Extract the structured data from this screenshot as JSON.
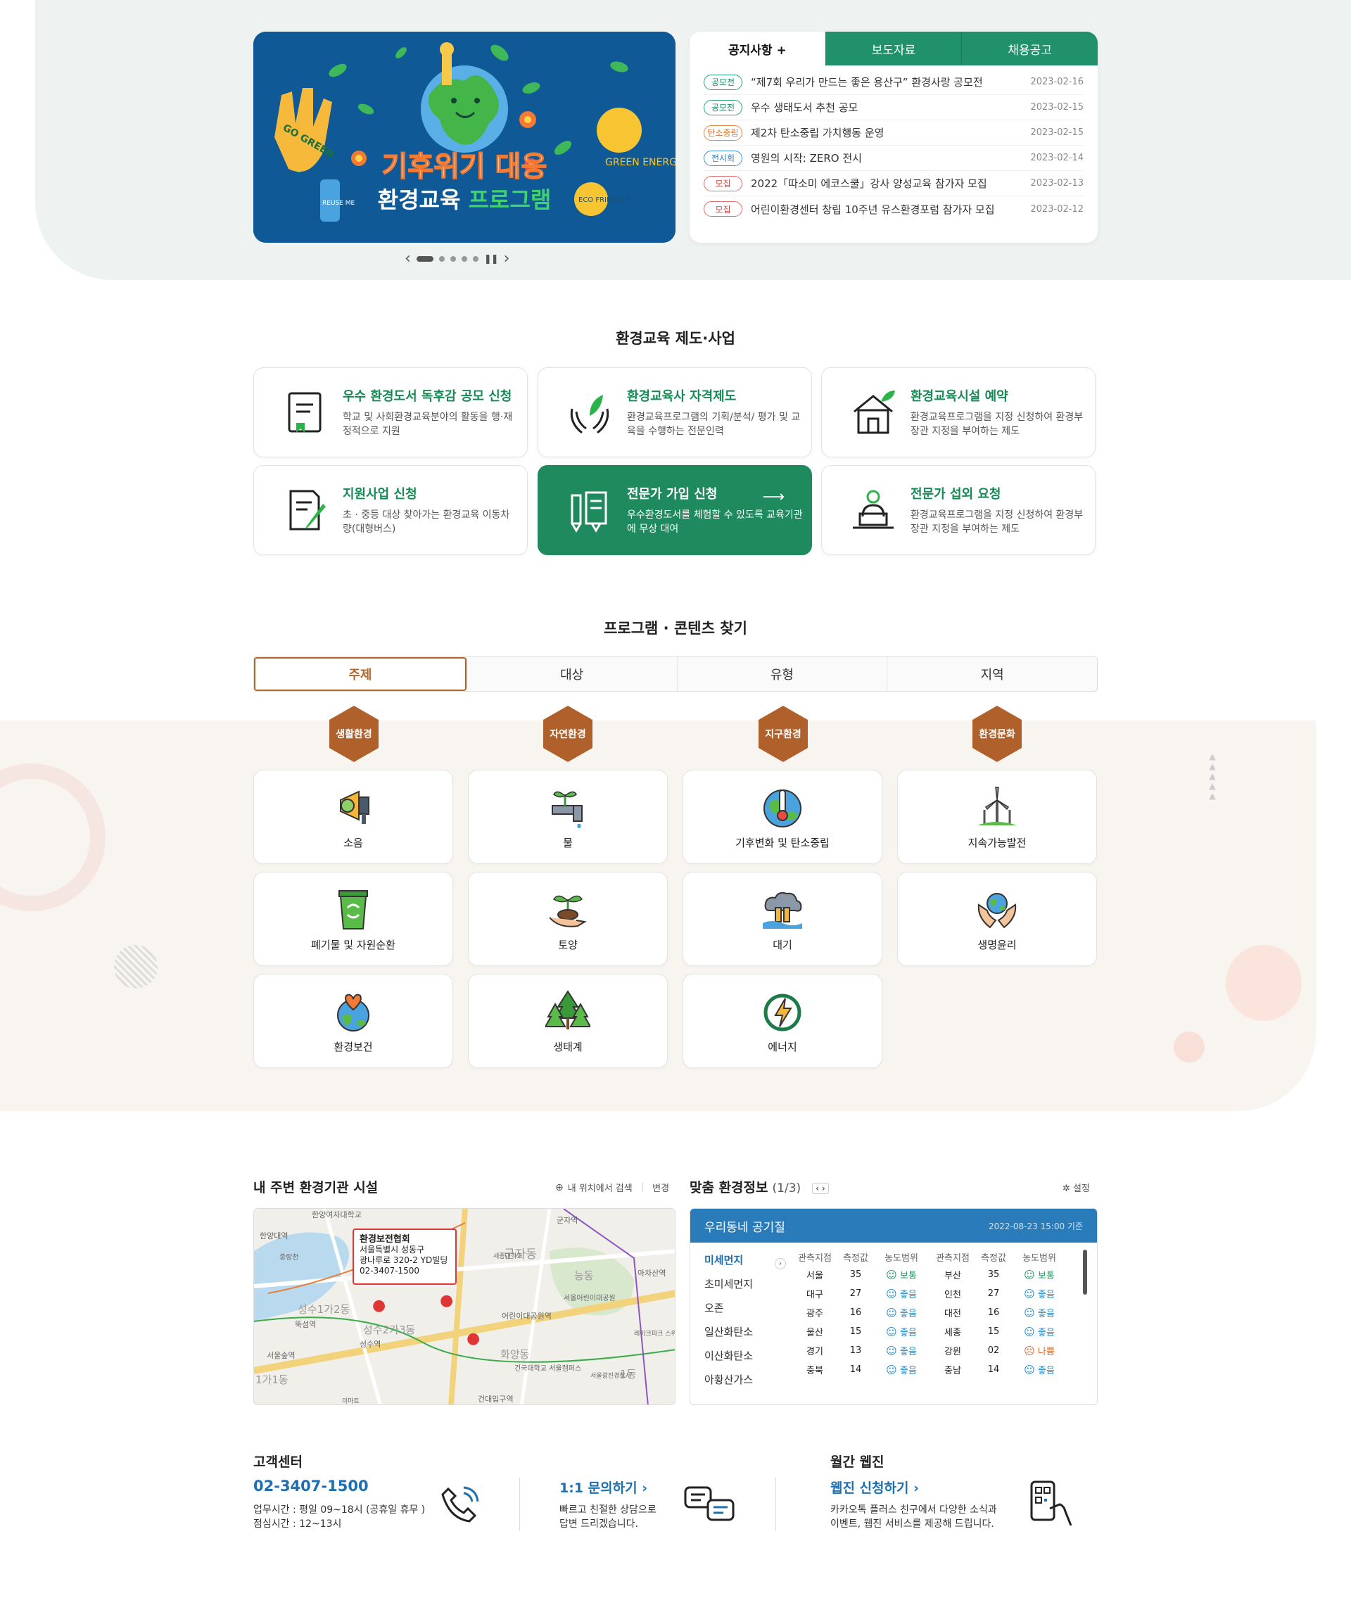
{
  "banner": {
    "title_line1": "기후위기 대응",
    "title_line2a": "환경교육 ",
    "title_line2b": "프로그램",
    "glove_text": "GO GREEN",
    "bottle_text": "REUSE ME",
    "sun_text": "GREEN ENERGY",
    "bulb_text": "ECO FRIENDLY",
    "slide_count": 5,
    "active_slide": 1
  },
  "notice": {
    "tabs": [
      "공지사항 +",
      "보도자료",
      "채용공고"
    ],
    "items": [
      {
        "tag": "공모전",
        "tag_color": "green",
        "title": "“제7회 우리가 만드는 좋은 용산구” 환경사랑 공모전",
        "date": "2023-02-16"
      },
      {
        "tag": "공모전",
        "tag_color": "green",
        "title": "우수 생태도서 추천 공모",
        "date": "2023-02-15"
      },
      {
        "tag": "탄소중립",
        "tag_color": "orange",
        "title": "제2차 탄소중립 가치행동 운영",
        "date": "2023-02-15"
      },
      {
        "tag": "전시회",
        "tag_color": "blue",
        "title": "영원의 시작: ZERO 전시",
        "date": "2023-02-14"
      },
      {
        "tag": "모집",
        "tag_color": "red",
        "title": "2022「따소미 에코스쿨」강사 양성교육 참가자 모집",
        "date": "2023-02-13"
      },
      {
        "tag": "모집",
        "tag_color": "red",
        "title": "어린이환경센터 창립 10주년 유스환경포럼 참가자 모집",
        "date": "2023-02-12"
      }
    ]
  },
  "system": {
    "title": "환경교육 제도·사업",
    "cards": [
      {
        "title": "우수 환경도서 독후감 공모 신청",
        "desc": "학교 및 사회환경교육분야의 활동을 행·재정적으로 지원",
        "icon": "book-icon"
      },
      {
        "title": "환경교육사 자격제도",
        "desc": "환경교육프로그램의 기획/분석/ 평가 및 교육을 수행하는 전문인력",
        "icon": "hands-leaf-icon"
      },
      {
        "title": "환경교육시설 예약",
        "desc": "환경교육프로그램을 지정 신청하여 환경부 장관 지정을 부여하는 제도",
        "icon": "house-leaf-icon"
      },
      {
        "title": "지원사업 신청",
        "desc": "초 · 중등 대상 찾아가는 환경교육 이동차량(대형버스)",
        "icon": "document-pen-icon"
      },
      {
        "title": "전문가 가입 신청",
        "desc": "우수환경도서를 체험할 수 있도록 교육기관에 무상 대여",
        "icon": "pencil-board-icon",
        "arrow": "⟶"
      },
      {
        "title": "전문가 섭외 요청",
        "desc": "환경교육프로그램을 지정 신청하여 환경부 장관 지정을 부여하는 제도",
        "icon": "expert-laptop-icon"
      }
    ]
  },
  "program": {
    "title": "프로그램 · 콘텐츠 찾기",
    "tabs": [
      "주제",
      "대상",
      "유형",
      "지역"
    ],
    "categories": [
      "생활환경",
      "자연환경",
      "지구환경",
      "환경문화"
    ],
    "tiles": [
      {
        "label": "소음",
        "icon": "megaphone-leaf-icon"
      },
      {
        "label": "물",
        "icon": "faucet-sprout-icon"
      },
      {
        "label": "기후변화 및 탄소중립",
        "icon": "globe-thermometer-icon"
      },
      {
        "label": "지속가능발전",
        "icon": "wind-turbine-icon"
      },
      {
        "label": "폐기물 및 자원순환",
        "icon": "recycle-bin-icon"
      },
      {
        "label": "토양",
        "icon": "soil-sprout-icon"
      },
      {
        "label": "대기",
        "icon": "cloud-factory-icon"
      },
      {
        "label": "생명윤리",
        "icon": "hands-globe-icon"
      },
      {
        "label": "환경보건",
        "icon": "globe-heart-icon"
      },
      {
        "label": "생태계",
        "icon": "forest-icon"
      },
      {
        "label": "에너지",
        "icon": "energy-bolt-icon"
      }
    ]
  },
  "nearby": {
    "title": "내 주변 환경기관 시설",
    "search_label": "내 위치에서 검색",
    "change_label": "변경",
    "popup": {
      "name": "환경보전협회",
      "addr1": "서울특별시 성동구",
      "addr2": "광나루로 320-2 YD빌딩",
      "phone": "02-3407-1500"
    },
    "map_labels": [
      "한양대역",
      "한양여자대학교",
      "군자역",
      "군자동",
      "능동",
      "서울어린이대공원",
      "아차산역",
      "성수1가2동",
      "뚝섬역",
      "성수2가3동",
      "성수역",
      "화양동",
      "건국대학교 서울캠퍼스",
      "1가1동",
      "서울숲역",
      "건대입구역",
      "어린이대공원역",
      "세종대학교",
      "레이크파크 스위트",
      "이마트",
      "서울광진경찰서",
      "중랑천",
      "1동"
    ]
  },
  "envinfo": {
    "title": "맞춤 환경정보",
    "page": "(1/3)",
    "setting_label": "설정",
    "panel_title": "우리동네 공기질",
    "timestamp": "2022-08-23 15:00 기준",
    "categories": [
      "미세먼지",
      "초미세먼지",
      "오존",
      "일산화탄소",
      "이산화탄소",
      "아황산가스"
    ],
    "headers": [
      "관측지점",
      "측정값",
      "농도범위",
      "관측지점",
      "측정값",
      "농도범위"
    ],
    "rows": [
      {
        "l_site": "서울",
        "l_val": "35",
        "l_state": "보통",
        "l_q": "ok",
        "r_site": "부산",
        "r_val": "35",
        "r_state": "보통",
        "r_q": "ok"
      },
      {
        "l_site": "대구",
        "l_val": "27",
        "l_state": "좋음",
        "l_q": "good",
        "r_site": "인천",
        "r_val": "27",
        "r_state": "좋음",
        "r_q": "good"
      },
      {
        "l_site": "광주",
        "l_val": "16",
        "l_state": "좋음",
        "l_q": "good",
        "r_site": "대전",
        "r_val": "16",
        "r_state": "좋음",
        "r_q": "good"
      },
      {
        "l_site": "울산",
        "l_val": "15",
        "l_state": "좋음",
        "l_q": "good",
        "r_site": "세종",
        "r_val": "15",
        "r_state": "좋음",
        "r_q": "good"
      },
      {
        "l_site": "경기",
        "l_val": "13",
        "l_state": "좋음",
        "l_q": "good",
        "r_site": "강원",
        "r_val": "02",
        "r_state": "나쁨",
        "r_q": "bad"
      },
      {
        "l_site": "충북",
        "l_val": "14",
        "l_state": "좋음",
        "l_q": "good",
        "r_site": "충남",
        "r_val": "14",
        "r_state": "좋음",
        "r_q": "good"
      }
    ]
  },
  "footer": {
    "cs_title": "고객센터",
    "phone": "02-3407-1500",
    "hours1": "업무시간 : 평일 09~18시 (공휴일 휴무 )",
    "hours2": "점심시간 : 12~13시",
    "inquiry_title": "1:1 문의하기 ›",
    "inquiry_desc1": "빠르고 친절한 상담으로",
    "inquiry_desc2": "답변 드리겠습니다.",
    "webzine_section": "월간 웹진",
    "webzine_title": "웹진 신청하기 ›",
    "webzine_desc1": "카카오톡 플러스 친구에서 다양한 소식과",
    "webzine_desc2": "이벤트, 웹진 서비스를 제공해 드립니다."
  },
  "colors": {
    "primary_green": "#1e8a5d",
    "accent_brown": "#b0602b",
    "blue": "#2a7bb9"
  }
}
